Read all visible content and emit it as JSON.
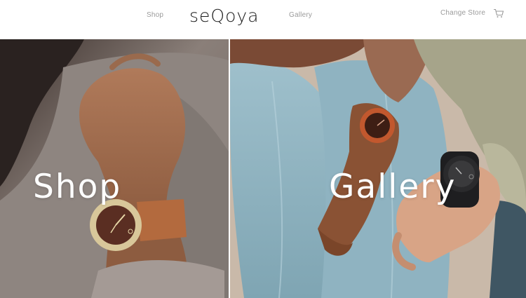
{
  "header": {
    "logo": "seQoya",
    "nav_shop": "Shop",
    "nav_gallery": "Gallery",
    "change_store": "Change Store",
    "cart_icon": "cart-icon"
  },
  "panels": {
    "shop": {
      "title": "Shop"
    },
    "gallery": {
      "title": "Gallery"
    }
  },
  "colors": {
    "text_dark": "#1c1c1c",
    "nav_gray": "#9a9a9a",
    "overlay_text": "#ffffff"
  }
}
